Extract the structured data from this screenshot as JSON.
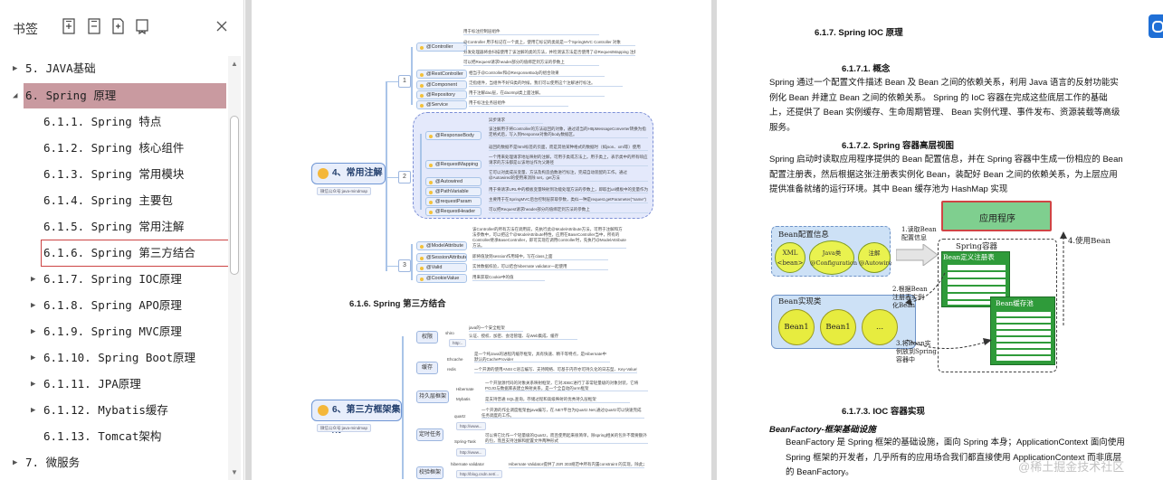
{
  "sidebar": {
    "title": "书签",
    "toc": [
      {
        "label": "5. JAVA基础",
        "level": 0,
        "expanded": false
      },
      {
        "label": "6. Spring 原理",
        "level": 0,
        "expanded": true
      },
      {
        "label": "6.1.1. Spring 特点",
        "level": 1
      },
      {
        "label": "6.1.2. Spring 核心组件",
        "level": 1
      },
      {
        "label": "6.1.3. Spring 常用模块",
        "level": 1
      },
      {
        "label": "6.1.4. Spring 主要包",
        "level": 1
      },
      {
        "label": "6.1.5. Spring 常用注解",
        "level": 1
      },
      {
        "label": "6.1.6. Spring 第三方结合",
        "level": 1
      },
      {
        "label": "6.1.7. Spring IOC原理",
        "level": 1,
        "has_children": true
      },
      {
        "label": "6.1.8. Spring APO原理",
        "level": 1,
        "has_children": true
      },
      {
        "label": "6.1.9. Spring MVC原理",
        "level": 1,
        "has_children": true
      },
      {
        "label": "6.1.10. Spring Boot原理",
        "level": 1,
        "has_children": true
      },
      {
        "label": "6.1.11. JPA原理",
        "level": 1,
        "has_children": true
      },
      {
        "label": "6.1.12. Mybatis缓存",
        "level": 1,
        "has_children": true
      },
      {
        "label": "6.1.13. Tomcat架构",
        "level": 1
      },
      {
        "label": "7.  微服务",
        "level": 0,
        "expanded": false
      }
    ],
    "toolbar_icons": [
      "bookmark-expand-icon",
      "bookmark-collapse-icon",
      "bookmark-add-icon",
      "bookmark-tag-icon",
      "close-icon"
    ]
  },
  "page_left": {
    "mindmap1": {
      "root": "4、常用注解",
      "root_tag": "微信公众号:java-mindmap",
      "group_nums": [
        "1",
        "2",
        "3"
      ],
      "nodes_g1": [
        "@Controller",
        "@RestController",
        "@Component",
        "@Repository",
        "@Service"
      ],
      "leaves_g1": [
        "用于标注控制层组件",
        "@Controller 用于标记在一个类上，使用它标记的类就是一个SpringMVC Controller 对象",
        "分发处理器将会扫描使用了该注解的类的方法，并检测该方法是否使用了@RequestMapping 注解。",
        "可以把Request请求header部分的值绑定到方法的参数上",
        "相当于@Controller和@ResponseBody的组合效果",
        "泛指组件，当组件不好归类的时候，我们可以使用这个注解进行标注。",
        "用于注解dao层，在daoImpl类上面注解。",
        "用于标注业务层组件"
      ],
      "nodes_g2": [
        "@ResponseBody",
        "@RequestMapping",
        "@Autowired",
        "@PathVariable",
        "@requestParam",
        "@RequestHeader"
      ],
      "leaves_g2": [
        "异步请求",
        "该注解用于将Controller的方法返回的对象，通过适当的HttpMessageConverter转换为指定格式后，写入到Response对象的body数据区。",
        "返回的数据不是html标签的页面，而是其他某种格式的数据时（如json、xml等）使用",
        "一个用来处理请求地址映射的注解，可用于类或方法上。用于类上，表示类中的所有响应请求的方法都是以该地址作为父路径",
        "它可以对类成员变量、方法及构造函数进行标注，完成自动装配的工作。通过 @Autowired的使用来消除 set，get方法",
        "用于将请求URL中的模板变量映射到功能处理方法的参数上，即取出uri模板中的变量作为参数",
        "主要用于在SpringMVC后台控制层获取参数，类似一种是request.getParameter(\"name\")",
        "可以把Request请求header部分的值绑定到方法的参数上"
      ],
      "nodes_g3": [
        "@ModelAttribute",
        "@SessionAttributes",
        "@Valid",
        "@CookieValue"
      ],
      "leaves_g3": [
        "该Controller的所有方法在调用前，先执行此@ModelAttribute方法，可用于注解和方法参数中，可以把这个@ModelAttribute特性，应用在BaseController当中，所有的Controller继承BaseController，即可实现在调用Controller时，先执行@ModelAttribute方法。",
        "即将值放到session作用域中，写在class上面",
        "实体数据校验，可以结合hibernate validator一起使用",
        "用来获取Cookie中的值"
      ]
    },
    "section_title": "6.1.6.  Spring 第三方结合",
    "mindmap2": {
      "root": "6、第三方框架集成",
      "root_tag": "微信公众号:java-mindmap",
      "categories": [
        "权限",
        "缓存",
        "持久层框架",
        "定时任务",
        "校验框架"
      ],
      "nodes": [
        "shiro",
        "Ehcache",
        "redis",
        "Hibernate",
        "Mybatis",
        "quartz",
        "Spring-Task",
        "hibernate validator"
      ],
      "leaves": [
        "java的一个安全框架",
        "认证、授权、加密、会话管理、与Web集成、缓存",
        "是一个纯Java的进程内缓存框架，具有快速、精干等特点，是Hibernate中默认的CacheProvider",
        "一个开源的使用ANSI C语言编写、支持网络、可基于内存亦可持久化的日志型、Key-Value数据库",
        "一个开放源代码的对象关系映射框架，它对JDBC进行了非常轻量级的对象封装，它将POJO与数据库表建立映射关系，是一个全自动的orm框架",
        "是支持普通 SQL查询，存储过程和高级映射的优秀持久层框架",
        "一个开源的作业调度框架由java编写，在.NET平台为Quartz.Net,通过Quartz可以快速完成任务调度的工作。",
        "可以将它比作一个轻量级的Quartz，而且使用起来很简单，除spring相关的包外不需要额外的包，而且支持注解和配置文件两种形式",
        "Hibernate Validator提供了JSR 303规范中所有内置constraint 的实现，除此之外还有一些附加的constraint。"
      ],
      "links": [
        "http:..",
        "http://www...",
        "http://blog.csdn.net/..."
      ]
    }
  },
  "page_right": {
    "h_section": "6.1.7.  Spring IOC 原理",
    "h_concept": "6.1.7.1.      概念",
    "p_concept": "Spring 通过一个配置文件描述 Bean 及 Bean 之间的依赖关系，利用 Java 语言的反射功能实例化 Bean 并建立 Bean 之间的依赖关系。 Spring 的 IoC 容器在完成这些底层工作的基础上，还提供了 Bean 实例缓存、生命周期管理、 Bean 实例代理、事件发布、资源装载等高级服务。",
    "h_container": "6.1.7.2.      Spring 容器高层视图",
    "p_container": "Spring 启动时读取应用程序提供的 Bean 配置信息，并在 Spring 容器中生成一份相应的 Bean 配置注册表，然后根据这张注册表实例化 Bean，装配好 Bean 之间的依赖关系，为上层应用提供准备就绪的运行环境。其中 Bean 缓存池为 HashMap 实现",
    "diagram": {
      "bean_config": "Bean配置信息",
      "xml": "XML",
      "xml_sub": "<bean>",
      "java_class": "Java类",
      "java_class_sub": "@Configuration",
      "annotation": "注解",
      "annotation_sub": "@Autowire",
      "app": "应用程序",
      "container": "Spring容器",
      "registry": "Bean定义注册表",
      "cache": "Bean缓存池",
      "bean_impl": "Bean实现类",
      "beans": [
        "Bean1",
        "Bean1",
        "..."
      ],
      "step1": "1.读取Bean\n配置信息",
      "step2": "2.根据Bean\n注册表实例\n化Bean",
      "step3": "3.将Bean实\n例放到Spring\n容器中",
      "step4": "4.使用Bean",
      "colors": {
        "bean_config_bg": "#cde1f6",
        "app_bg": "#7fcf8f",
        "app_border": "#d04444",
        "registry_bg": "#2f9b3a",
        "ellipse_bg": "#e9f24f"
      }
    },
    "h_impl": "6.1.7.3.      IOC 容器实现",
    "em_beanfactory": "BeanFactory-框架基础设施",
    "p_impl": "BeanFactory 是 Spring 框架的基础设施，面向 Spring 本身；ApplicationContext 面向使用 Spring 框架的开发者，几乎所有的应用场合我们都直接使用 ApplicationContext 而非底层的 BeanFactory。"
  },
  "watermark": "@稀土掘金技术社区"
}
